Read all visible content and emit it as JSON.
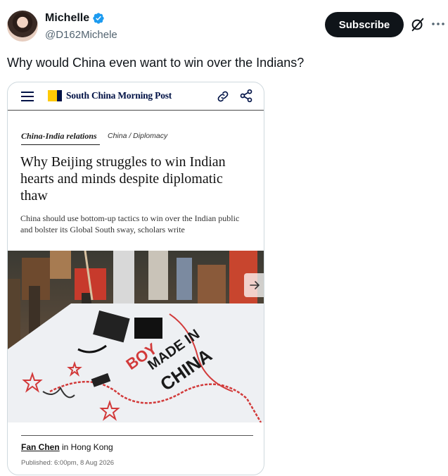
{
  "author": {
    "display_name": "Michelle",
    "handle": "@D162Michele",
    "verified_color": "#1d9bf0"
  },
  "actions": {
    "subscribe_label": "Subscribe",
    "grok_icon": "grok-icon",
    "more_icon": "more-icon"
  },
  "tweet": {
    "text": "Why would China even want to win over the Indians?"
  },
  "article": {
    "publisher": "South China Morning Post",
    "publisher_logo_color": "#ffca05",
    "publisher_color": "#001246",
    "section": "China-India relations",
    "subsection": "China / Diplomacy",
    "headline": "Why Beijing struggles to win Indian hearts and minds despite diplomatic thaw",
    "subheadline": "China should use bottom-up tactics to win over the Indian public and bolster its Global South sway, scholars write",
    "byline_author": "Fan Chen",
    "byline_location": " in Hong Kong",
    "published": "Published: 6:00pm, 8 Aug 2026",
    "photo_text": "BOYCOTT MADE IN CHINA"
  }
}
